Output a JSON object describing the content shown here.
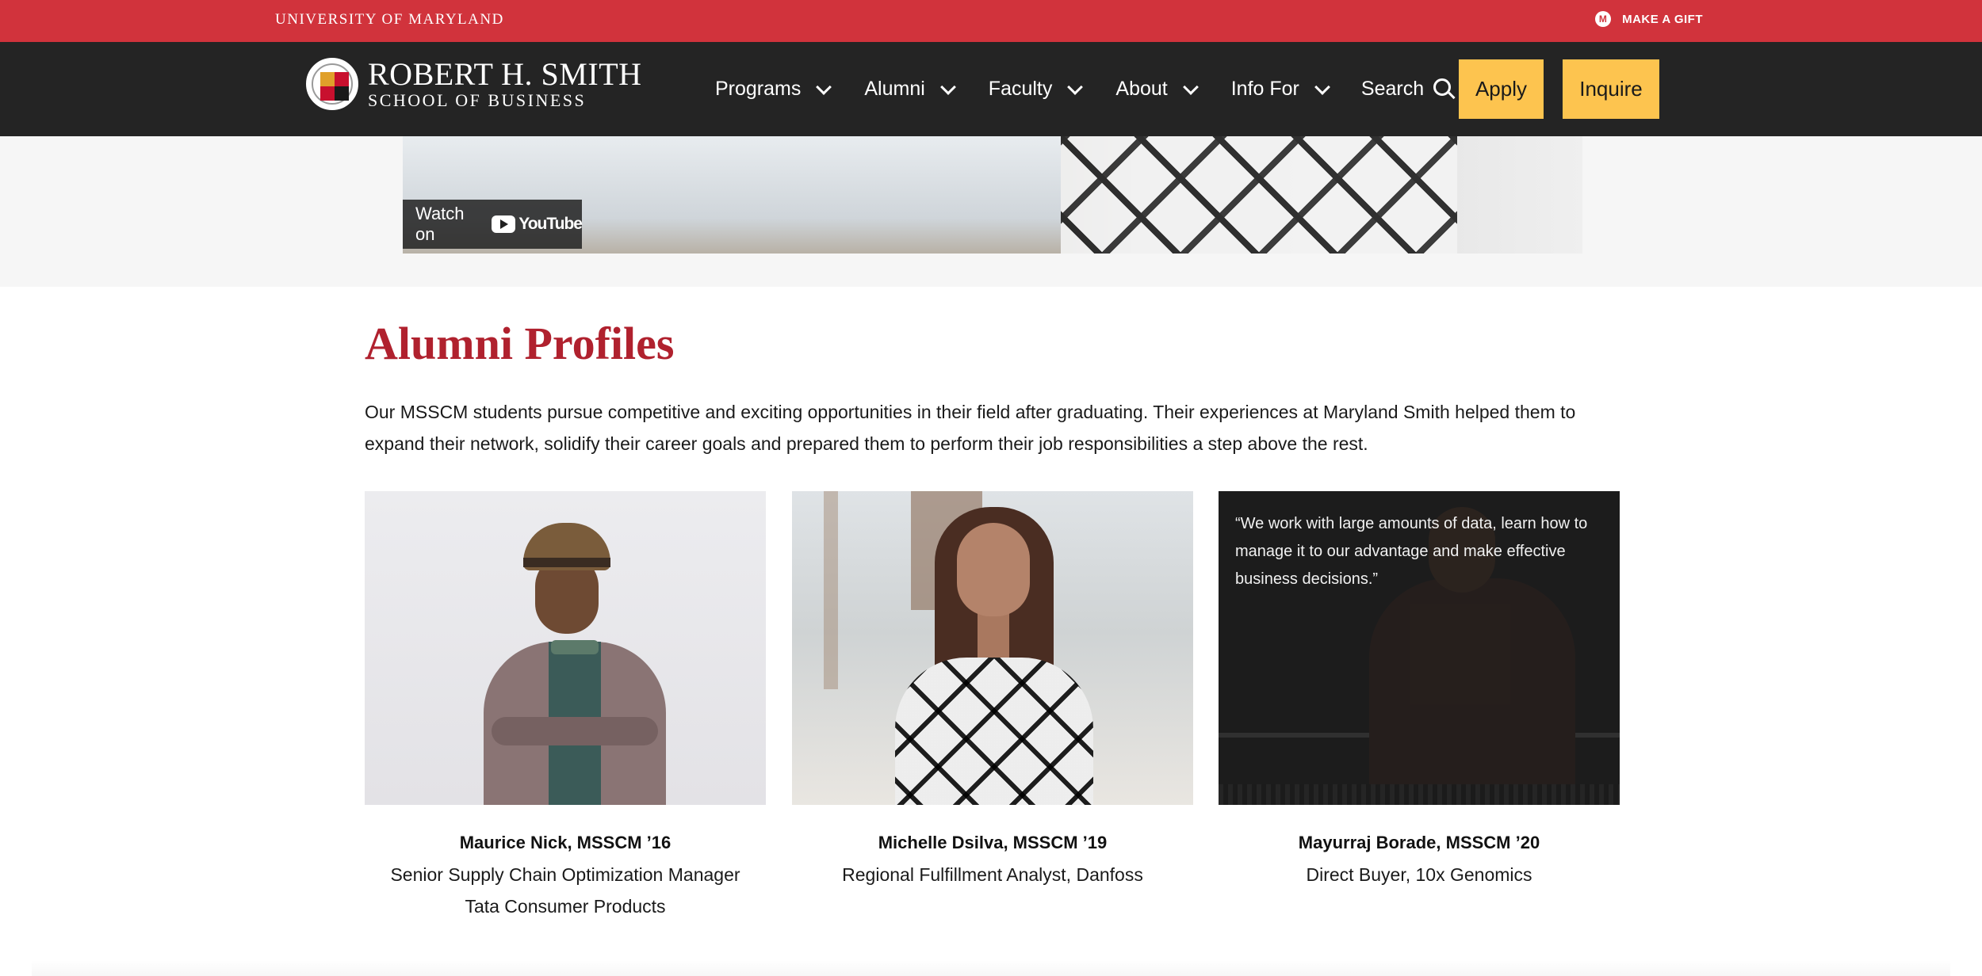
{
  "topbar": {
    "university": "UNIVERSITY OF MARYLAND",
    "gift_label": "MAKE A GIFT",
    "gift_icon": "M"
  },
  "brand": {
    "line1": "ROBERT H. SMITH",
    "line2": "SCHOOL OF BUSINESS"
  },
  "nav": {
    "items": [
      {
        "label": "Programs"
      },
      {
        "label": "Alumni"
      },
      {
        "label": "Faculty"
      },
      {
        "label": "About"
      },
      {
        "label": "Info For"
      }
    ],
    "search_label": "Search",
    "apply_label": "Apply",
    "inquire_label": "Inquire"
  },
  "video": {
    "watch_label": "Watch on",
    "platform": "YouTube"
  },
  "section": {
    "title": "Alumni Profiles",
    "intro": "Our MSSCM students pursue competitive and exciting opportunities in their field after graduating. Their experiences at Maryland Smith helped them to expand their network, solidify their career goals and prepared them to perform their job responsibilities a step above the rest."
  },
  "profiles": [
    {
      "name": "Maurice Nick, MSSCM ’16",
      "role": "Senior Supply Chain Optimization Manager Tata Consumer Products"
    },
    {
      "name": "Michelle Dsilva, MSSCM ’19",
      "role": "Regional Fulfillment Analyst, Danfoss"
    },
    {
      "name": "Mayurraj Borade, MSSCM ’20",
      "role": "Direct Buyer, 10x Genomics",
      "quote": "“We work with large amounts of data, learn how to manage it to our advantage and make effective business decisions.”"
    }
  ],
  "colors": {
    "brand_red": "#d1333c",
    "title_red": "#b0212e",
    "nav_bg": "#242424",
    "button_yellow": "#fdc44f"
  }
}
